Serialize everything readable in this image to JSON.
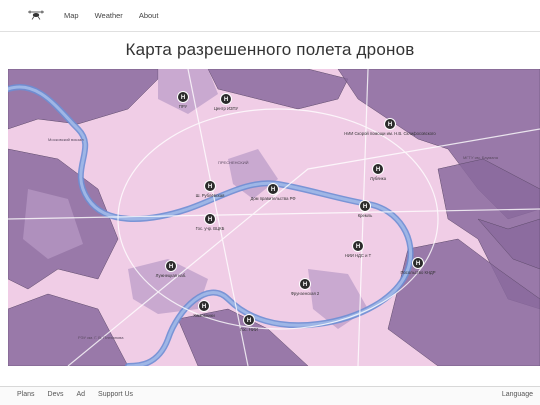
{
  "nav": {
    "logo_icon": "drone-icon",
    "links": [
      "Map",
      "Weather",
      "About"
    ]
  },
  "page": {
    "title": "Карта разрешенного полета дронов"
  },
  "map": {
    "markers": [
      {
        "label": "ПРУ"
      },
      {
        "label": "Центр ИЗПУ"
      },
      {
        "label": "НИИ Скорой помощи им. Н.В. Склифосовского"
      },
      {
        "label": "Лубянка"
      },
      {
        "label": "Дом правительства РФ"
      },
      {
        "label": "Кремль"
      },
      {
        "label": "Ш. Рублёвская"
      },
      {
        "label": "Гос. учр. ВЦКБ"
      },
      {
        "label": "НИИ НДС и Т"
      },
      {
        "label": "Лужнецкая наб."
      },
      {
        "label": "Фрунзенская 2"
      },
      {
        "label": "Посольство КНДР"
      },
      {
        "label": "Хамовники"
      },
      {
        "label": "Гос. НИИ"
      }
    ],
    "places": [
      "ПРЕСНЕНСКИЙ",
      "Московский вокзал",
      "РЭУ им. Г. В. Плеханова",
      "МГТУ им. Баумана"
    ]
  },
  "footer": {
    "links": [
      "Plans",
      "Devs",
      "Ad",
      "Support Us"
    ],
    "language": "Language"
  }
}
